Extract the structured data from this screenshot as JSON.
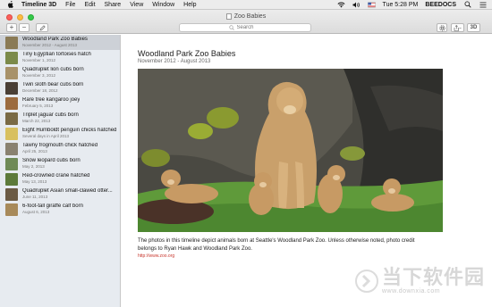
{
  "menubar": {
    "app_name": "Timeline 3D",
    "menus": [
      "File",
      "Edit",
      "Share",
      "View",
      "Window",
      "Help"
    ],
    "clock": "Tue 5:28 PM",
    "user": "BEEDOCS"
  },
  "window": {
    "title": "Zoo Babies",
    "search_placeholder": "Search",
    "add_label": "+",
    "remove_label": "−",
    "view_3d_label": "3D"
  },
  "timeline": [
    {
      "title": "Woodland Park Zoo Babies",
      "date": "November 2012 - August 2013",
      "selected": true,
      "thumb_color": "#8a7a55"
    },
    {
      "title": "Tiny Egyptian tortoises hatch",
      "date": "November 1, 2012",
      "thumb_color": "#7b8a4a"
    },
    {
      "title": "Quadruplet lion cubs born",
      "date": "November 3, 2012",
      "thumb_color": "#a8926a"
    },
    {
      "title": "Twin sloth bear cubs born",
      "date": "December 18, 2012",
      "thumb_color": "#4a3f36"
    },
    {
      "title": "Rare tree kangaroo joey",
      "date": "February 5, 2013",
      "thumb_color": "#9c6b3f"
    },
    {
      "title": "Triplet jaguar cubs born",
      "date": "March 22, 2013",
      "thumb_color": "#7a6a45"
    },
    {
      "title": "Eight Humboldt penguin chicks hatched",
      "date": "Several days in April 2013",
      "thumb_color": "#d8c060"
    },
    {
      "title": "Tawny frogmouth chick hatched",
      "date": "April 25, 2013",
      "thumb_color": "#8a8270"
    },
    {
      "title": "Snow leopard cubs born",
      "date": "May 2, 2013",
      "thumb_color": "#6f8a56"
    },
    {
      "title": "Red-crowned crane hatched",
      "date": "May 13, 2013",
      "thumb_color": "#5d7a3a"
    },
    {
      "title": "Quadruplet Asian small-clawed otter...",
      "date": "June 11, 2013",
      "thumb_color": "#6b5a44"
    },
    {
      "title": "6-foot-tall giraffe calf born",
      "date": "August 6, 2013",
      "thumb_color": "#a88a5a"
    }
  ],
  "detail": {
    "title": "Woodland Park Zoo Babies",
    "subtitle": "November 2012 - August 2013",
    "caption": "The photos in this timeline depict animals born at Seattle's Woodland Park Zoo. Unless otherwise noted, photo credit belongs to Ryan Hawk and Woodland Park Zoo.",
    "link": "http://www.zoo.org"
  },
  "watermark": {
    "brand": "当下软件园",
    "url": "www.downxia.com"
  },
  "colors": {
    "sidebar_bg": "#e7ebf0",
    "selected_bg": "#cdd1d7",
    "link": "#c8372d"
  }
}
